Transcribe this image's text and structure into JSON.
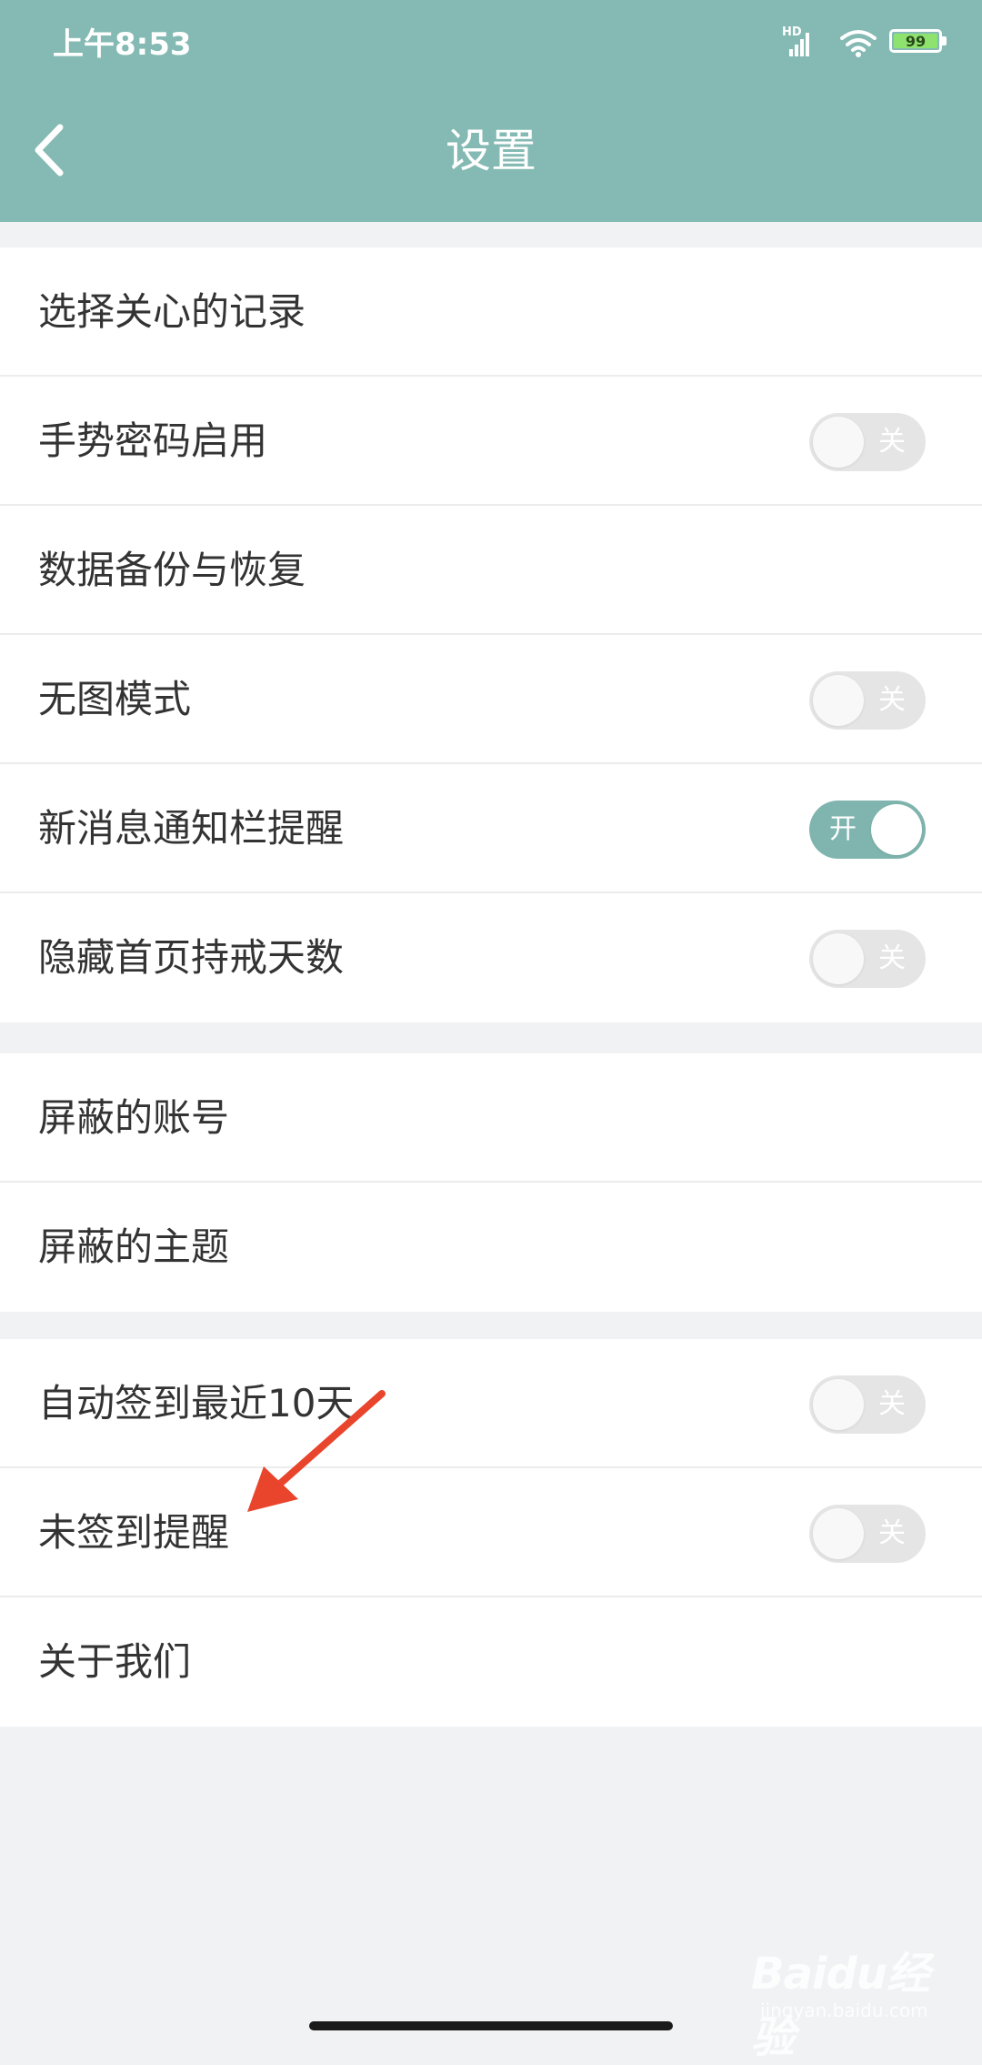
{
  "status_bar": {
    "time": "上午8:53",
    "network": "HD",
    "battery": "99"
  },
  "header": {
    "title": "设置"
  },
  "groups": [
    {
      "items": [
        {
          "label": "选择关心的记录"
        },
        {
          "label": "手势密码启用",
          "toggle": "关",
          "on": false
        },
        {
          "label": "数据备份与恢复"
        },
        {
          "label": "无图模式",
          "toggle": "关",
          "on": false
        },
        {
          "label": "新消息通知栏提醒",
          "toggle": "开",
          "on": true
        },
        {
          "label": "隐藏首页持戒天数",
          "toggle": "关",
          "on": false
        }
      ]
    },
    {
      "items": [
        {
          "label": "屏蔽的账号"
        },
        {
          "label": "屏蔽的主题"
        }
      ]
    },
    {
      "items": [
        {
          "label": "自动签到最近10天",
          "toggle": "关",
          "on": false
        },
        {
          "label": "未签到提醒",
          "toggle": "关",
          "on": false
        },
        {
          "label": "关于我们"
        }
      ]
    }
  ],
  "watermark": {
    "logo": "Baidu经验",
    "sub": "jingyan.baidu.com"
  },
  "colors": {
    "header_bg": "#84bab3",
    "toggle_on": "#7fb5ae",
    "toggle_off": "#e5e5e5",
    "arrow": "#e8452c"
  }
}
